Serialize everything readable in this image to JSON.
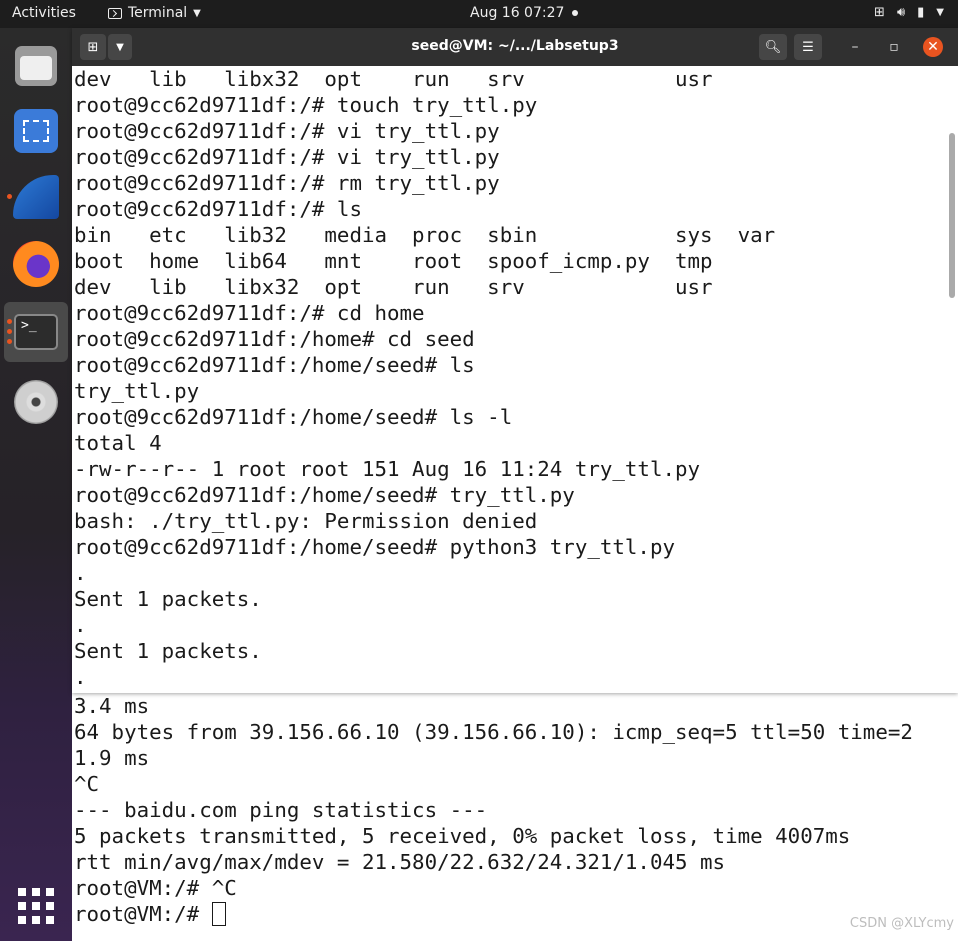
{
  "topbar": {
    "activities": "Activities",
    "app_name": "Terminal",
    "clock": "Aug 16  07:27"
  },
  "dock": {
    "items": [
      "files",
      "screenshot",
      "wireshark",
      "firefox",
      "terminal",
      "disc"
    ]
  },
  "window": {
    "title": "seed@VM: ~/.../Labsetup3"
  },
  "front_lines": [
    "dev   lib   libx32  opt    run   srv            usr",
    "root@9cc62d9711df:/# touch try_ttl.py",
    "root@9cc62d9711df:/# vi try_ttl.py",
    "root@9cc62d9711df:/# vi try_ttl.py",
    "root@9cc62d9711df:/# rm try_ttl.py",
    "root@9cc62d9711df:/# ls",
    "bin   etc   lib32   media  proc  sbin           sys  var",
    "boot  home  lib64   mnt    root  spoof_icmp.py  tmp",
    "dev   lib   libx32  opt    run   srv            usr",
    "root@9cc62d9711df:/# cd home",
    "root@9cc62d9711df:/home# cd seed",
    "root@9cc62d9711df:/home/seed# ls",
    "try_ttl.py",
    "root@9cc62d9711df:/home/seed# ls -l",
    "total 4",
    "-rw-r--r-- 1 root root 151 Aug 16 11:24 try_ttl.py",
    "root@9cc62d9711df:/home/seed# try_ttl.py",
    "bash: ./try_ttl.py: Permission denied",
    "root@9cc62d9711df:/home/seed# python3 try_ttl.py",
    ".",
    "Sent 1 packets.",
    ".",
    "Sent 1 packets.",
    "."
  ],
  "back_lines": [
    "3.4 ms",
    "64 bytes from 39.156.66.10 (39.156.66.10): icmp_seq=5 ttl=50 time=2",
    "1.9 ms",
    "^C",
    "--- baidu.com ping statistics ---",
    "5 packets transmitted, 5 received, 0% packet loss, time 4007ms",
    "rtt min/avg/max/mdev = 21.580/22.632/24.321/1.045 ms",
    "root@VM:/# ^C"
  ],
  "back_prompt": "root@VM:/# ",
  "watermark": "CSDN @XLYcmy"
}
